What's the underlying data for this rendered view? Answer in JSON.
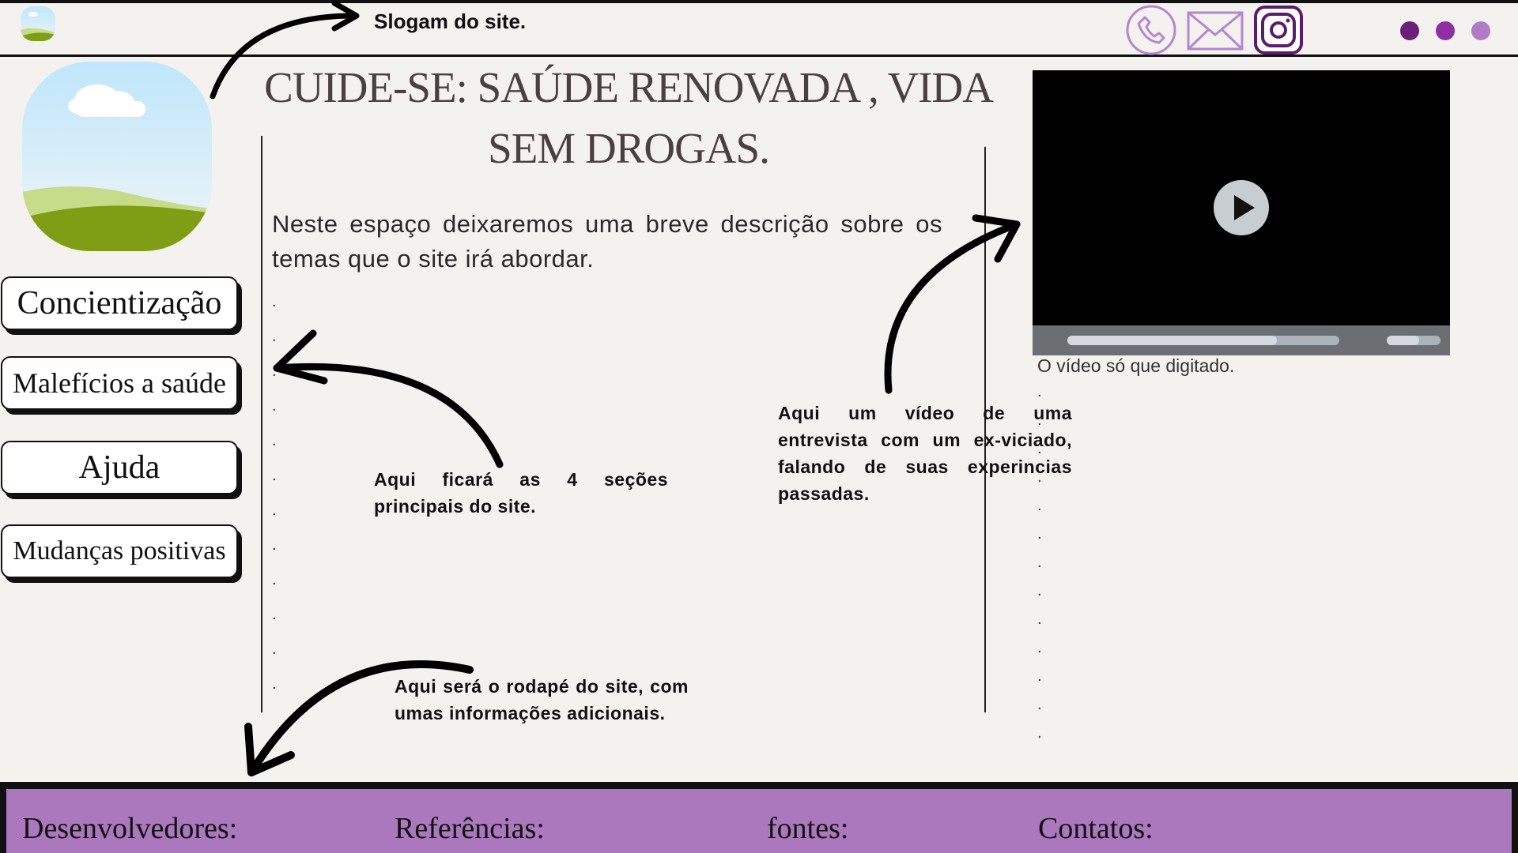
{
  "header": {
    "slogan": "Slogam do site.",
    "icons": [
      "phone-icon",
      "mail-icon",
      "instagram-icon"
    ],
    "dot_colors": [
      "#6b1f7a",
      "#8e2fa6",
      "#b07cc8"
    ]
  },
  "nav": {
    "items": [
      "Concientização",
      "Malefícios a saúde",
      "Ajuda",
      "Mudanças positivas"
    ]
  },
  "main": {
    "title_line1": "CUIDE-SE: SAÚDE RENOVADA , VIDA",
    "title_line2": "SEM DROGAS.",
    "description": "Neste espaço deixaremos uma breve descrição sobre os temas que o site irá abordar."
  },
  "annotations": {
    "sections_note": "Aqui ficará as 4 seções principais do site.",
    "video_note": "Aqui um vídeo de uma entrevista com um ex-viciado, falando de suas experincias passadas.",
    "footer_note": "Aqui será o rodapé do site, com umas informações adicionais."
  },
  "video": {
    "caption": "O vídeo só que digitado.",
    "progress": 0.77
  },
  "footer": {
    "developers": "Desenvolvedores:",
    "references": "Referências:",
    "sources": "fontes:",
    "contacts": "Contatos:"
  },
  "colors": {
    "background": "#f4f2ee",
    "footer": "#ab78bd",
    "accent_purple": "#5b1d6b",
    "icon_lilac": "#b586cf"
  }
}
